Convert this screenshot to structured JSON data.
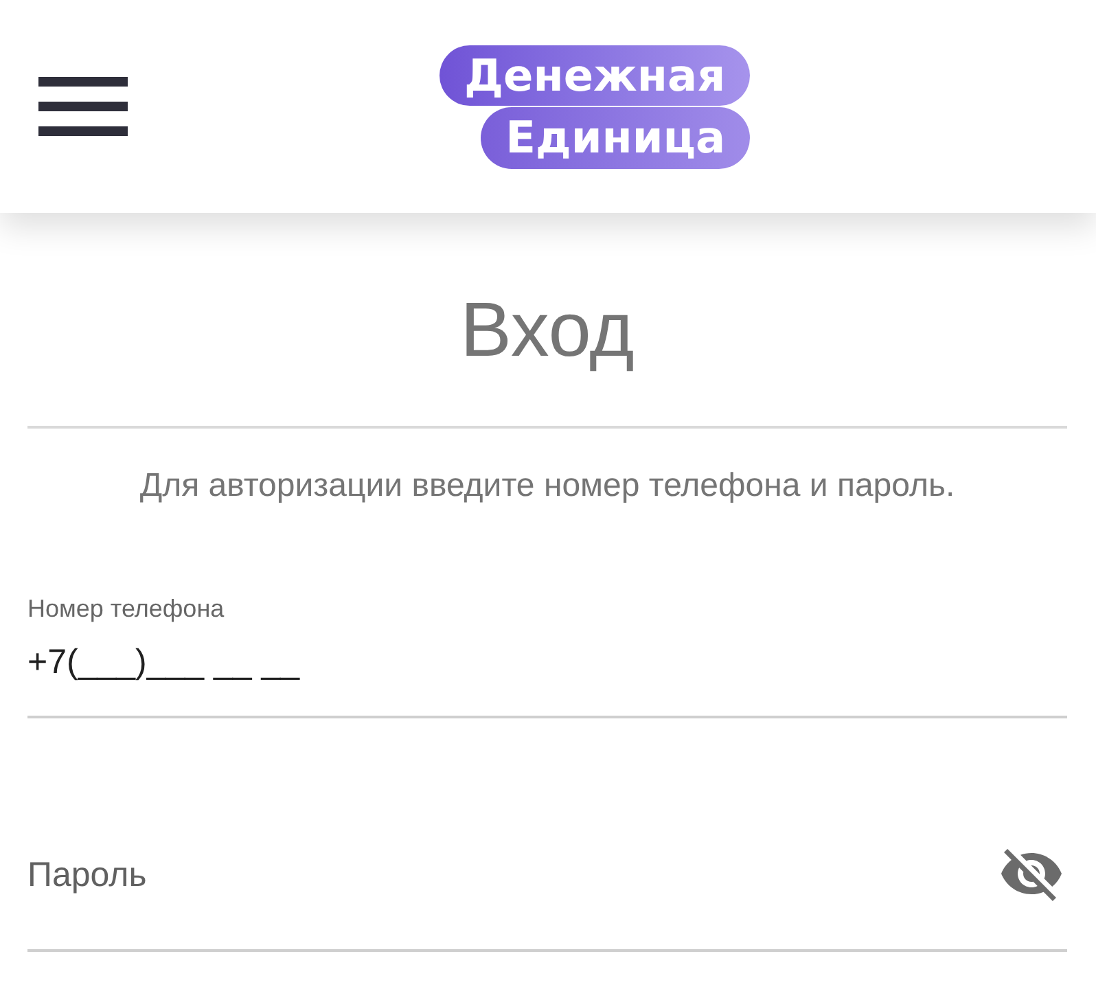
{
  "header": {
    "logo": {
      "line_1": "Денежная",
      "line_2": "Единица"
    }
  },
  "title": "Вход",
  "instructions": "Для авторизации введите номер телефона и пароль.",
  "fields": [
    {
      "kind": "phone",
      "label": "Номер телефона",
      "value": "+7(___)___ __ __"
    },
    {
      "kind": "password",
      "label": "Пароль",
      "password_visible": false
    }
  ]
}
